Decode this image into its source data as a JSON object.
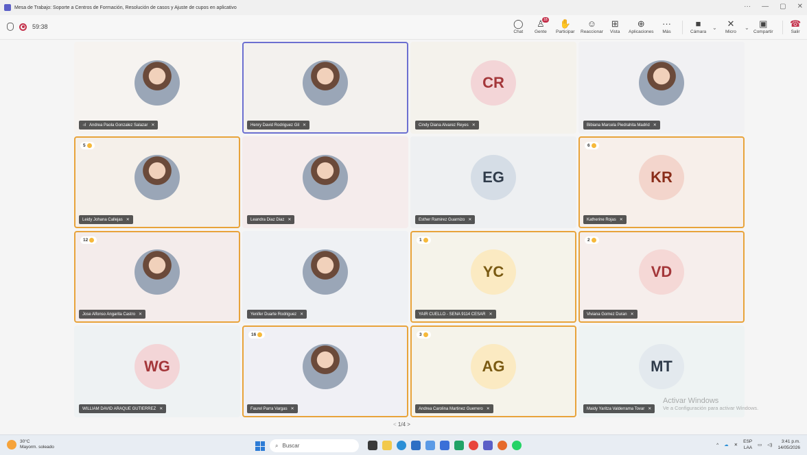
{
  "window": {
    "title": "Mesa de Trabajo: Soporte a Centros de Formación, Resolución de casos y Ajuste de cupos en aplicativo"
  },
  "meeting": {
    "timer": "59:38",
    "page_indicator": "1/4"
  },
  "toolbar": {
    "chat": "Chat",
    "people": "Gente",
    "people_badge": "18",
    "raise": "Participar",
    "react": "Reaccionar",
    "view": "Vista",
    "apps": "Aplicaciones",
    "more": "Más",
    "camera": "Cámara",
    "mic": "Micro",
    "share": "Compartir",
    "leave": "Salir"
  },
  "participants": [
    {
      "name": "Andrea Paola Gonzalez Salazar",
      "prefix": "·ıl",
      "initials": "",
      "photo": true,
      "hand": "",
      "state": "normal",
      "bg": "#f6f3f0",
      "avatar_bg": "",
      "avatar_fg": ""
    },
    {
      "name": "Henry David Rodriguez Gil",
      "prefix": "",
      "initials": "",
      "photo": true,
      "hand": "",
      "state": "speaking",
      "bg": "#f3f1ee",
      "avatar_bg": "",
      "avatar_fg": ""
    },
    {
      "name": "Cindy Diana Alvarez Reyes",
      "prefix": "",
      "initials": "CR",
      "photo": false,
      "hand": "",
      "state": "normal",
      "bg": "#f4f2ec",
      "avatar_bg": "#f3d5d7",
      "avatar_fg": "#a4373a"
    },
    {
      "name": "Bibiana Marcela Piedrahita Madrid",
      "prefix": "",
      "initials": "",
      "photo": true,
      "hand": "",
      "state": "normal",
      "bg": "#f1f1f3",
      "avatar_bg": "",
      "avatar_fg": ""
    },
    {
      "name": "Leidy Johana Callejas",
      "prefix": "",
      "initials": "",
      "photo": true,
      "hand": "5",
      "state": "raised",
      "bg": "#f5f0ea",
      "avatar_bg": "",
      "avatar_fg": ""
    },
    {
      "name": "Leandra Diaz Diaz",
      "prefix": "",
      "initials": "",
      "photo": true,
      "hand": "",
      "state": "normal",
      "bg": "#f5ecec",
      "avatar_bg": "",
      "avatar_fg": ""
    },
    {
      "name": "Esther Ramirez Guarnizo",
      "prefix": "",
      "initials": "EG",
      "photo": false,
      "hand": "",
      "state": "normal",
      "bg": "#eef0f2",
      "avatar_bg": "#d5dde6",
      "avatar_fg": "#2f3b4a"
    },
    {
      "name": "Katherine Rojas",
      "prefix": "",
      "initials": "KR",
      "photo": false,
      "hand": "6",
      "state": "raised",
      "bg": "#f7efea",
      "avatar_bg": "#f3d5cc",
      "avatar_fg": "#8a2d1a"
    },
    {
      "name": "Jose Alfonso Angarita Castro",
      "prefix": "",
      "initials": "",
      "photo": true,
      "hand": "12",
      "state": "raised",
      "bg": "#f4eceb",
      "avatar_bg": "",
      "avatar_fg": ""
    },
    {
      "name": "Yenifer Duarte Rodriguez",
      "prefix": "",
      "initials": "",
      "photo": true,
      "hand": "",
      "state": "normal",
      "bg": "#eff1f4",
      "avatar_bg": "",
      "avatar_fg": ""
    },
    {
      "name": "YAIR CUELLO - SENA 9114 CESAR",
      "prefix": "",
      "initials": "YC",
      "photo": false,
      "hand": "1",
      "state": "raised",
      "bg": "#f5f3ea",
      "avatar_bg": "#fbeac2",
      "avatar_fg": "#7a5a12"
    },
    {
      "name": "Viviana Gomez Duran",
      "prefix": "",
      "initials": "VD",
      "photo": false,
      "hand": "2",
      "state": "raised",
      "bg": "#f6eeec",
      "avatar_bg": "#f5d8d6",
      "avatar_fg": "#a4373a"
    },
    {
      "name": "WILLIAM DAVID ARAQUE GUTIERREZ",
      "prefix": "",
      "initials": "WG",
      "photo": false,
      "hand": "",
      "state": "normal",
      "bg": "#eef2f3",
      "avatar_bg": "#f3d5d7",
      "avatar_fg": "#a4373a"
    },
    {
      "name": "Faurel Parra Vargas",
      "prefix": "",
      "initials": "",
      "photo": true,
      "hand": "16",
      "state": "raised",
      "bg": "#f0f0f5",
      "avatar_bg": "",
      "avatar_fg": ""
    },
    {
      "name": "Andrea Carolina Martinez Guerrero",
      "prefix": "",
      "initials": "AG",
      "photo": false,
      "hand": "3",
      "state": "raised",
      "bg": "#f5f3ea",
      "avatar_bg": "#fbeac2",
      "avatar_fg": "#7a5a12"
    },
    {
      "name": "Maidy Yaritza Valderrama Tovar",
      "prefix": "",
      "initials": "MT",
      "photo": false,
      "hand": "",
      "state": "normal",
      "bg": "#eef3f3",
      "avatar_bg": "#e3e9ee",
      "avatar_fg": "#2f3b4a"
    }
  ],
  "watermark": {
    "title": "Activar Windows",
    "sub": "Ve a Configuración para activar Windows."
  },
  "taskbar": {
    "weather_temp": "30°C",
    "weather_desc": "Mayorm. soleado",
    "search_placeholder": "Buscar",
    "lang": "ESP",
    "lang_sub": "LAA",
    "time": "3:41 p.m.",
    "date": "14/05/2026"
  }
}
